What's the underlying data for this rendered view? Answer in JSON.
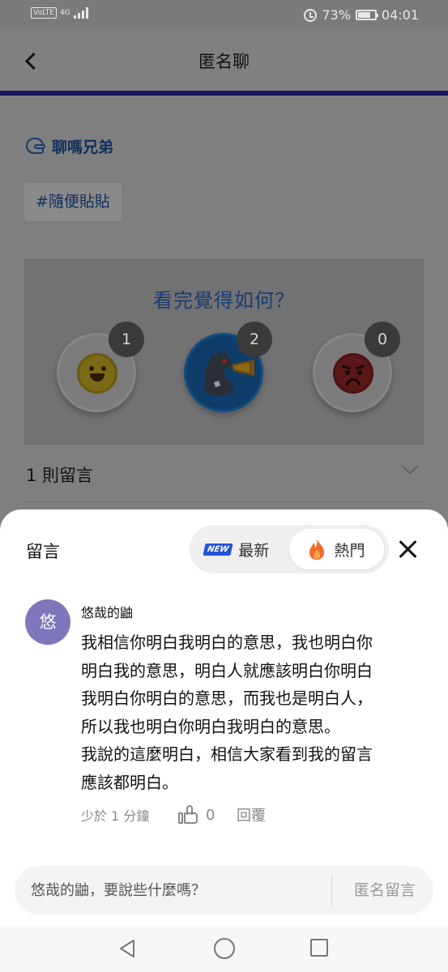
{
  "status_bar": {
    "network_badge": "VoLTE",
    "network_type": "4G",
    "battery": "73%",
    "battery_level": 0.73,
    "time": "04:01"
  },
  "header": {
    "title": "匿名聊",
    "back_icon": "chevron-left-icon"
  },
  "post": {
    "author": "聊嗎兄弟",
    "tag": "#隨便貼貼"
  },
  "reactions": {
    "question": "看完覺得如何？",
    "items": [
      {
        "name": "smile",
        "count": "1",
        "selected": false
      },
      {
        "name": "godzilla",
        "count": "2",
        "selected": true
      },
      {
        "name": "angry",
        "count": "0",
        "selected": false
      }
    ]
  },
  "comments_summary": {
    "label": "1 則留言"
  },
  "sheet": {
    "title": "留言",
    "sort": {
      "new_badge": "NEW",
      "new_label": "最新",
      "hot_label": "熱門",
      "selected": "hot"
    },
    "comments": [
      {
        "avatar_text": "悠",
        "author": "悠哉的鼬",
        "text": "我相信你明白我明白的意思，我也明白你\n明白我的意思，明白人就應該明白你明白\n我明白你明白的意思，而我也是明白人，\n所以我也明白你明白我明白的意思。\n我說的這麼明白，相信大家看到我的留言\n應該都明白。",
        "time": "少於 1 分鐘",
        "likes": "0",
        "reply_label": "回覆"
      }
    ],
    "input": {
      "placeholder": "悠哉的鼬，要說些什麼嗎？",
      "submit_label": "匿名留言"
    }
  },
  "colors": {
    "accent_blue": "#2f6fd0",
    "header_line": "#1a1a66",
    "avatar_purple": "#7f77bc",
    "new_badge_blue": "#2453d9",
    "flame_orange": "#f26a2b"
  }
}
